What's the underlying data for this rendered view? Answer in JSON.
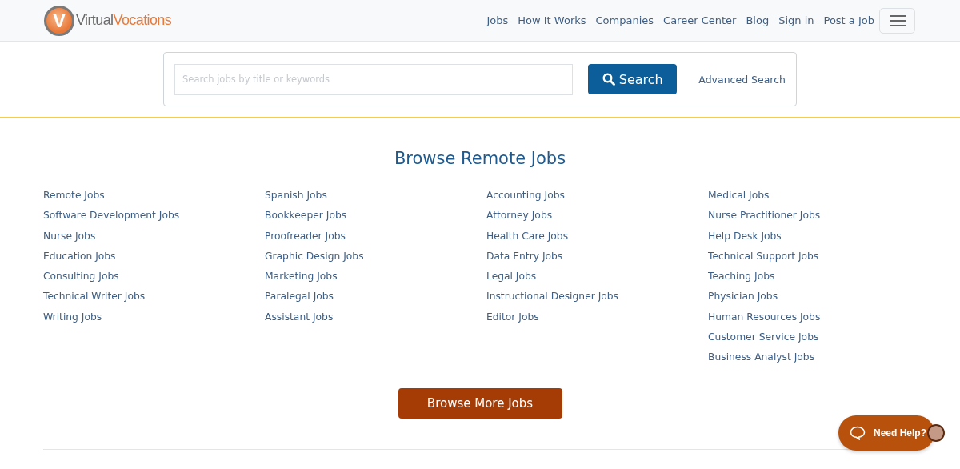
{
  "logo": {
    "mark": "V",
    "name_dark": "Virtual",
    "name_accent": "Vocations"
  },
  "nav": {
    "links": [
      "Jobs",
      "How It Works",
      "Companies",
      "Career Center",
      "Blog",
      "Sign in",
      "Post a Job"
    ]
  },
  "search": {
    "placeholder": "Search jobs by title or keywords",
    "button": "Search",
    "advanced": "Advanced Search"
  },
  "browse": {
    "title": "Browse Remote Jobs",
    "columns": [
      [
        "Remote Jobs",
        "Software Development Jobs",
        "Nurse Jobs",
        "Education Jobs",
        "Consulting Jobs",
        "Technical Writer Jobs",
        "Writing Jobs"
      ],
      [
        "Spanish Jobs",
        "Bookkeeper Jobs",
        "Proofreader Jobs",
        "Graphic Design Jobs",
        "Marketing Jobs",
        "Paralegal Jobs",
        "Assistant Jobs"
      ],
      [
        "Accounting Jobs",
        "Attorney Jobs",
        "Health Care Jobs",
        "Data Entry Jobs",
        "Legal Jobs",
        "Instructional Designer Jobs",
        "Editor Jobs"
      ],
      [
        "Medical Jobs",
        "Nurse Practitioner Jobs",
        "Help Desk Jobs",
        "Technical Support Jobs",
        "Teaching Jobs",
        "Physician Jobs",
        "Human Resources Jobs",
        "Customer Service Jobs",
        "Business Analyst Jobs"
      ]
    ],
    "more_button": "Browse More Jobs"
  },
  "help": {
    "label": "Need Help?"
  }
}
